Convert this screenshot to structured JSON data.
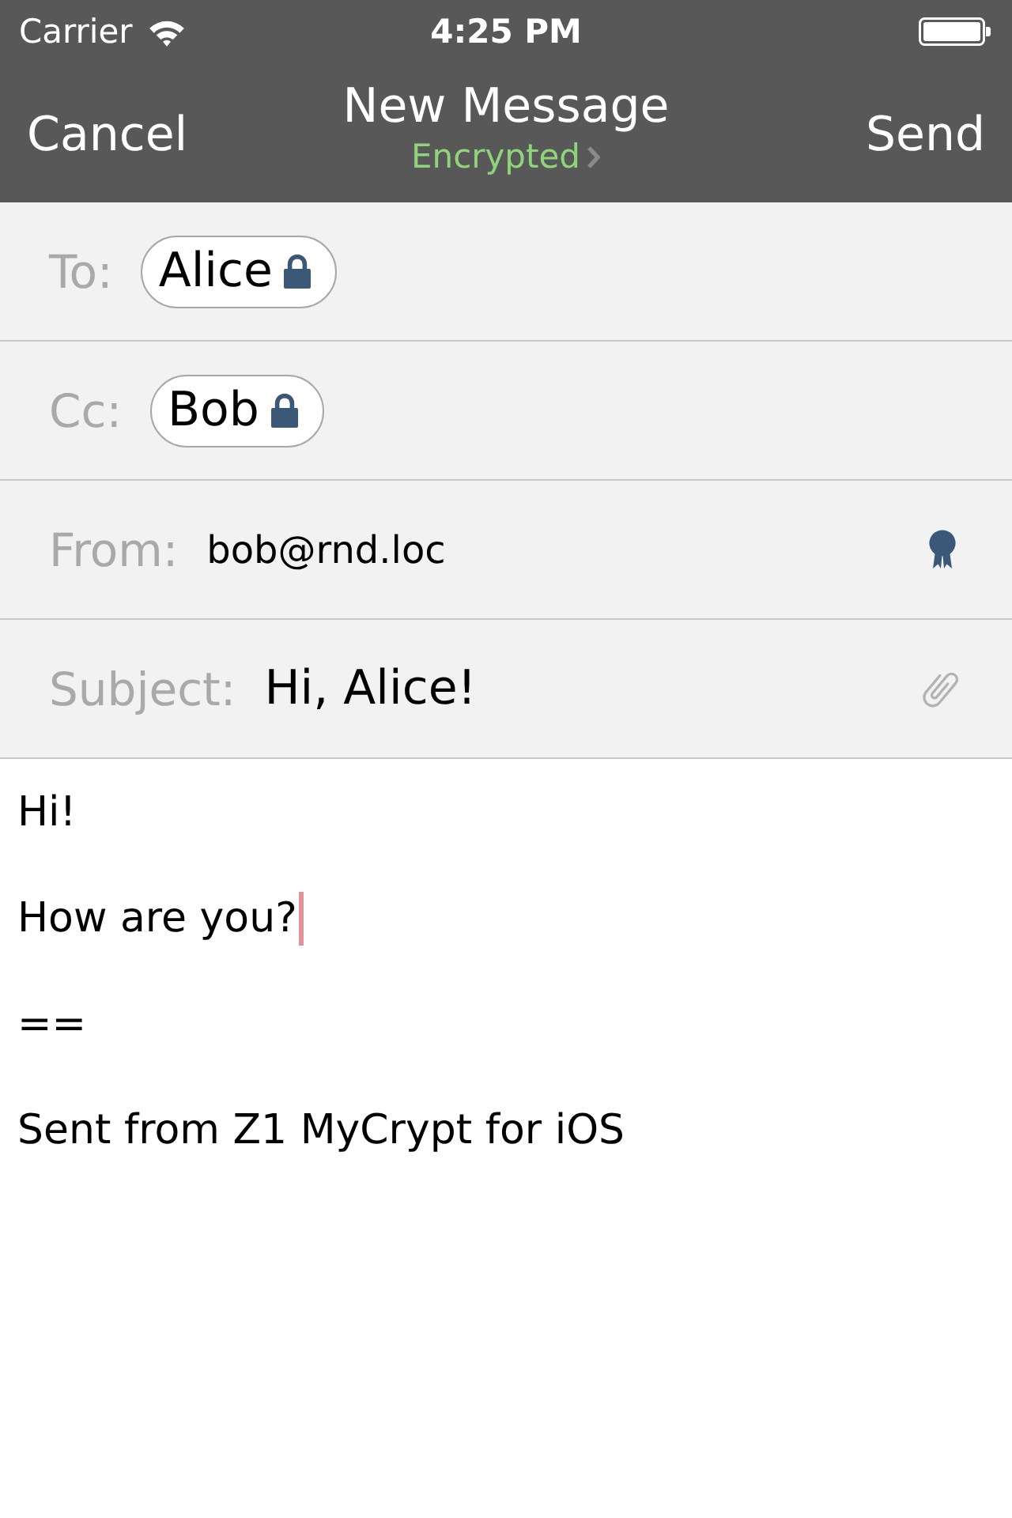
{
  "status_bar": {
    "carrier": "Carrier",
    "time": "4:25 PM"
  },
  "nav_bar": {
    "left_button": "Cancel",
    "title": "New Message",
    "subtitle": "Encrypted",
    "right_button": "Send"
  },
  "fields": [
    {
      "kind": "recipients",
      "label": "To:",
      "recipients": [
        {
          "name": "Alice",
          "encrypted": true
        }
      ]
    },
    {
      "kind": "recipients",
      "label": "Cc:",
      "recipients": [
        {
          "name": "Bob",
          "encrypted": true
        }
      ]
    },
    {
      "kind": "sender",
      "label": "From:",
      "value": "bob@rnd.loc"
    },
    {
      "kind": "subject",
      "label": "Subject:",
      "value": "Hi, Alice!"
    }
  ],
  "body": {
    "lines": [
      {
        "text": "Hi!",
        "cursor": false
      },
      {
        "text": "How are you?",
        "cursor": true
      },
      {
        "text": "==",
        "cursor": false
      },
      {
        "text": "Sent from Z1 MyCrypt for iOS",
        "cursor": false
      }
    ]
  }
}
